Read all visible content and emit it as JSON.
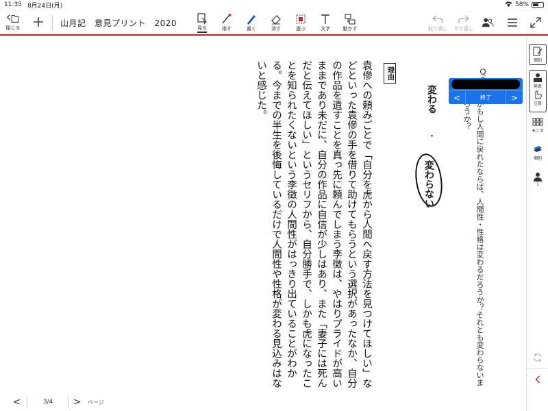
{
  "status": {
    "time": "11:35",
    "date": "8月24日(月)",
    "battery": "58%",
    "battery_level": 0.58
  },
  "toolbar": {
    "close_label": "閉じる",
    "title": "山月記　意見プリント　2020",
    "tools": [
      {
        "label": "見る",
        "icon": "look-icon"
      },
      {
        "label": "指す",
        "icon": "pointer-icon"
      },
      {
        "label": "書く",
        "icon": "pen-icon"
      },
      {
        "label": "消す",
        "icon": "eraser-icon"
      },
      {
        "label": "選ぶ",
        "icon": "select-icon"
      },
      {
        "label": "文字",
        "icon": "text-icon"
      },
      {
        "label": "動かす",
        "icon": "move-icon"
      }
    ],
    "undo_label": "取り消し",
    "redo_label": "やり直し"
  },
  "document": {
    "question_number": "Ｑ３",
    "question_text": "李徴がもし人間に戻れたならば、人間性・性格は変わるだろうか？それとも変わらないままだろうか？",
    "option_a": "変わる",
    "option_separator": "・",
    "option_b": "変わらない",
    "reason_label": "理由",
    "answer_text": "袁傪への頼みごとで「自分を虎から人間へ戻す方法を見つけてほしい」などといった袁傪の手を借りて助けてもらうという選択があったなか、自分の作品を遺すことを真っ先に頼んでしまう李徴は、やはりプライドが高いままであり未だに、自分の作品に自信が少しはあり、また「妻子には死んだと伝えてほしい」というセリフから、自分勝手で、しかも虎になったことを知られたくないという李徴の人間性がはっきり出ていることがわかる。今までの半生を後悔しているだけで人間性や性格が変わる見込みはないと感じた。"
  },
  "float_nav": {
    "prev": "<",
    "end": "終了",
    "next": ">"
  },
  "sidebar": {
    "items": [
      {
        "label": "個別",
        "icon": "edit-sheet-icon"
      },
      {
        "label": "発表",
        "icon": "presenter-icon"
      },
      {
        "label": "注目",
        "icon": "hand-attention-icon"
      },
      {
        "label": "モニタ",
        "icon": "monitor-grid-icon"
      },
      {
        "label": "個別",
        "icon": "stack-icon"
      },
      {
        "label": "1",
        "icon": "person-icon"
      }
    ]
  },
  "pager": {
    "prev": "<",
    "info": "3/4",
    "next": ">",
    "label": "ページ"
  }
}
